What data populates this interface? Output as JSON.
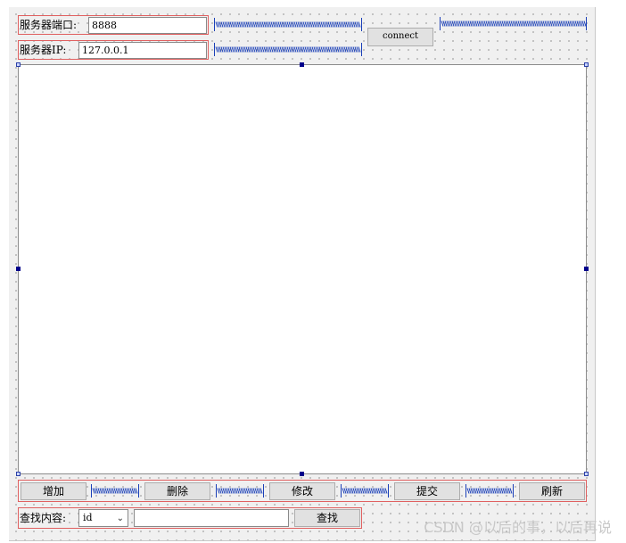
{
  "server": {
    "port_label": "服务器端口:",
    "port_value": "8888",
    "ip_label": "服务器IP:",
    "ip_value": "127.0.0.1",
    "connect_label": "connect"
  },
  "actions": {
    "add_label": "增加",
    "delete_label": "删除",
    "modify_label": "修改",
    "submit_label": "提交",
    "refresh_label": "刷新"
  },
  "search": {
    "label": "查找内容:",
    "field_selected": "id",
    "query_value": "",
    "button_label": "查找"
  },
  "watermark": "CSDN @以后的事，以后再说",
  "colors": {
    "layout_outline": "#e06060",
    "spacer": "#1a3fb8",
    "selection_handle": "#00008b"
  }
}
